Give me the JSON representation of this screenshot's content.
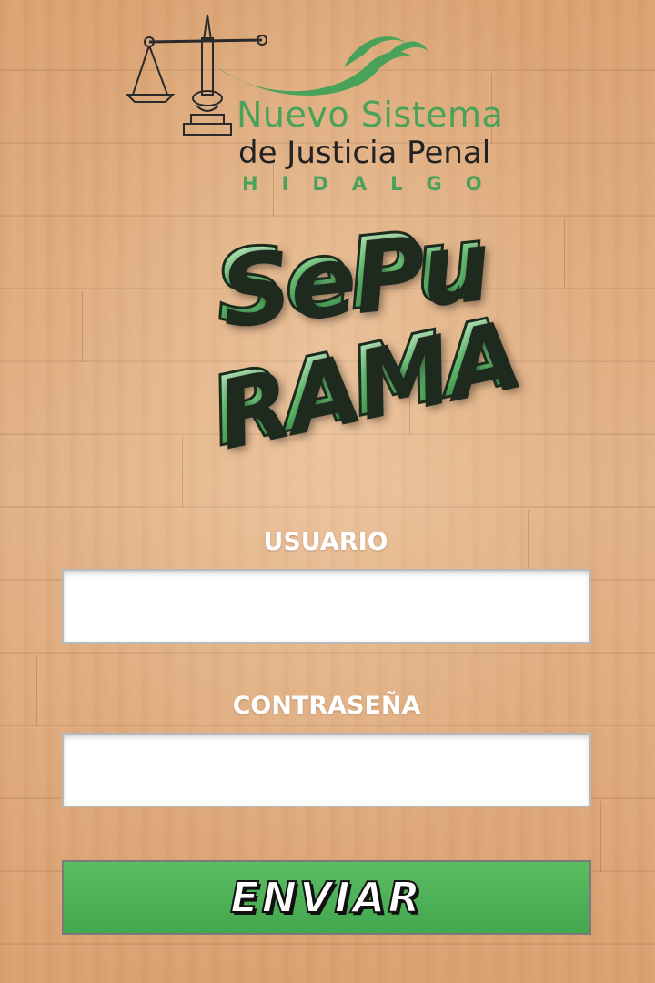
{
  "header": {
    "logo_icon": "scales-of-justice-icon",
    "logo_line1": "Nuevo Sistema",
    "logo_line2": "de Justicia Penal",
    "logo_line3": "HIDALGO"
  },
  "game": {
    "title_line1": "SePu",
    "title_line2": "RAMA"
  },
  "form": {
    "username_label": "USUARIO",
    "username_value": "",
    "password_label": "CONTRASEÑA",
    "password_value": "",
    "submit_label": "ENVIAR"
  },
  "colors": {
    "brand_green": "#4aa25a",
    "button_green": "#4caf50",
    "wood": "#dba97c",
    "label_white": "#ffffff",
    "logo_dark": "#222222"
  }
}
